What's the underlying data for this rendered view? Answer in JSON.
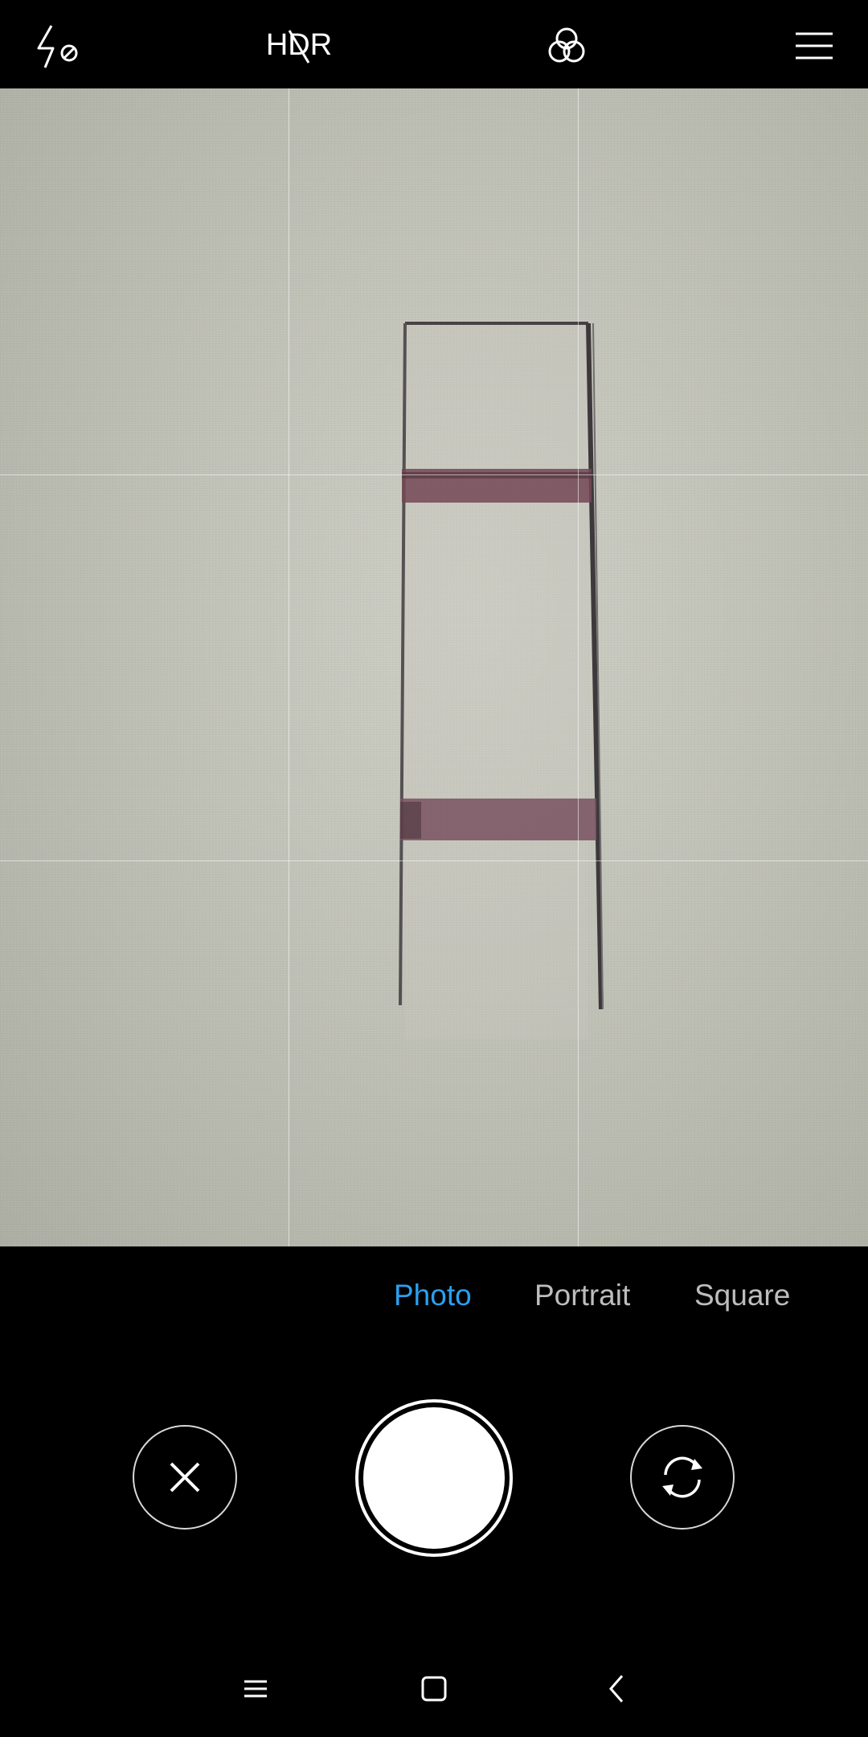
{
  "top_bar": {
    "flash_icon": "flash-off-icon",
    "hdr_label": "HDR",
    "hdr_state": "off",
    "filters_icon": "filters-icon",
    "menu_icon": "menu-icon"
  },
  "modes": {
    "items": [
      {
        "label": "Photo",
        "active": true
      },
      {
        "label": "Portrait",
        "active": false
      },
      {
        "label": "Square",
        "active": false
      }
    ],
    "active_color": "#2ba0f0"
  },
  "controls": {
    "close_icon": "close-icon",
    "shutter_icon": "shutter-icon",
    "switch_camera_icon": "switch-camera-icon"
  },
  "nav_bar": {
    "recents_icon": "recents-icon",
    "home_icon": "home-icon",
    "back_icon": "back-icon"
  }
}
